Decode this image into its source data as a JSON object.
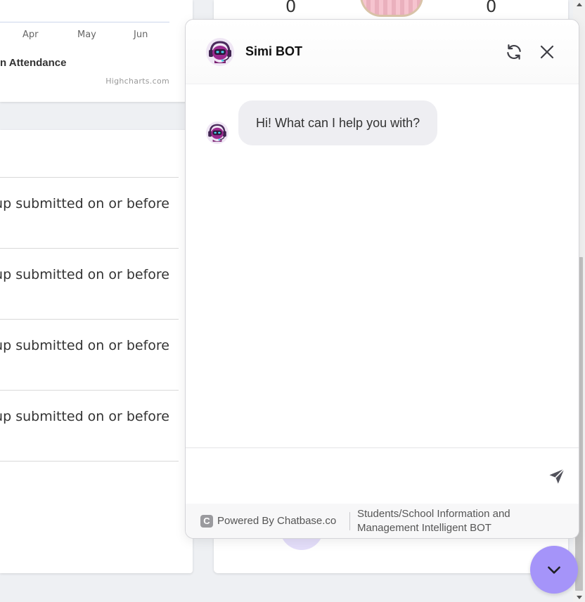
{
  "chart_card": {
    "months": [
      "Apr",
      "May",
      "Jun"
    ],
    "title": "n Attendance",
    "credit": "Highcharts.com"
  },
  "assignments": {
    "rows": [
      {
        "text": "oup submitted on or before"
      },
      {
        "text": "oup submitted on or before"
      },
      {
        "text": "oup submitted on or before"
      },
      {
        "text": "oup submitted on or before"
      }
    ]
  },
  "stats": {
    "left_value": "0",
    "right_value": "0"
  },
  "chat": {
    "bot_name": "Simi BOT",
    "greeting": "Hi! What can I help you with?",
    "input_value": "",
    "footer": {
      "logo_letter": "C",
      "powered_by": "Powered By Chatbase.co",
      "description": "Students/School Information and Management Intelligent BOT"
    },
    "accent_color": "#a594f9"
  },
  "icons": {
    "refresh": "refresh-icon",
    "close": "close-icon",
    "send": "send-icon",
    "toggle": "chevron-down-icon"
  }
}
